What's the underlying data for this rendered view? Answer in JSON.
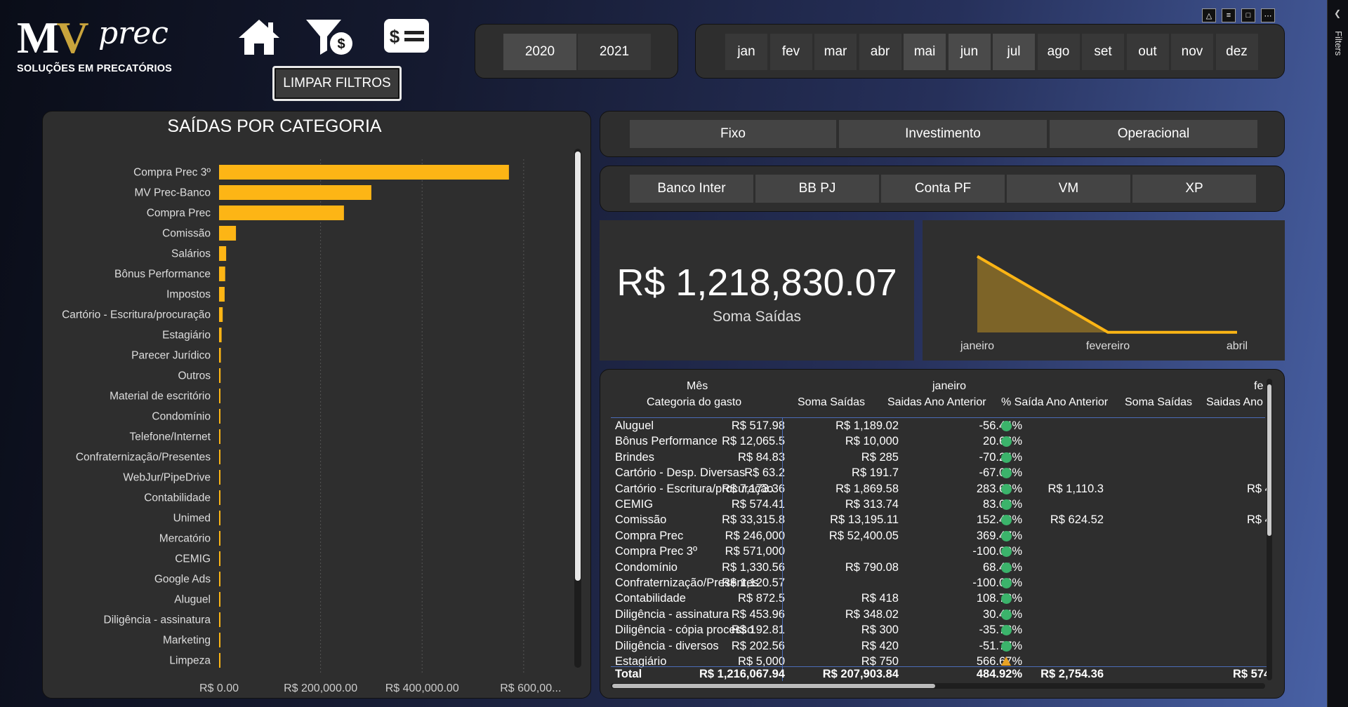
{
  "logo": {
    "text_main": "MV",
    "text_script": "prec",
    "subtitle": "SOLUÇÕES EM PRECATÓRIOS"
  },
  "header": {
    "clear_filters": "LIMPAR FILTROS",
    "icons": [
      "home-icon",
      "filter-money-icon",
      "money-list-icon"
    ]
  },
  "years": {
    "items": [
      "2020",
      "2021"
    ],
    "selected": "2020"
  },
  "months": {
    "items": [
      "jan",
      "fev",
      "mar",
      "abr",
      "mai",
      "jun",
      "jul",
      "ago",
      "set",
      "out",
      "nov",
      "dez"
    ],
    "selected": [
      "mai",
      "jun",
      "jul"
    ]
  },
  "categories_slicer": [
    "Fixo",
    "Investimento",
    "Operacional"
  ],
  "accounts_slicer": [
    "Banco Inter",
    "BB PJ",
    "Conta PF",
    "VM",
    "XP"
  ],
  "filters_pane": {
    "label": "Filters"
  },
  "kpi": {
    "value": "R$ 1,218,830.07",
    "label": "Soma Saídas"
  },
  "colors": {
    "bar": "#fdb515",
    "area_fill": "#7d6428",
    "area_line": "#fdb515",
    "positive_dot": "#3bb36b",
    "warning": "#e8a224"
  },
  "chart_data": [
    {
      "type": "bar",
      "orientation": "horizontal",
      "title": "SAÍDAS POR CATEGORIA",
      "categories": [
        "Compra Prec 3º",
        "MV Prec-Banco",
        "Compra Prec",
        "Comissão",
        "Salários",
        "Bônus Performance",
        "Impostos",
        "Cartório - Escritura/procuração",
        "Estagiário",
        "Parecer Jurídico",
        "Outros",
        "Material de escritório",
        "Condomínio",
        "Telefone/Internet",
        "Confraternização/Presentes",
        "WebJur/PipeDrive",
        "Contabilidade",
        "Unimed",
        "Mercatório",
        "CEMIG",
        "Google Ads",
        "Aluguel",
        "Diligência - assinatura",
        "Marketing",
        "Limpeza"
      ],
      "values": [
        571000,
        300000,
        246000,
        33316,
        14000,
        12066,
        11000,
        7173,
        5000,
        3500,
        3000,
        2500,
        1331,
        1300,
        1121,
        1000,
        873,
        800,
        700,
        574,
        550,
        518,
        454,
        400,
        300
      ],
      "xlim": [
        0,
        650000
      ],
      "ticks": [
        "R$ 0.00",
        "R$ 200,000.00",
        "R$ 400,000.00",
        "R$ 600,00..."
      ],
      "tick_values": [
        0,
        200000,
        400000,
        600000
      ]
    },
    {
      "type": "area",
      "categories": [
        "janeiro",
        "fevereiro",
        "abril"
      ],
      "values": [
        1216067.94,
        2754.36,
        2700
      ],
      "ylim": [
        0,
        1300000
      ]
    },
    {
      "type": "table",
      "column_group_label": "Mês",
      "row_header": "Categoria do gasto",
      "month_groups": [
        "janeiro",
        "fe"
      ],
      "columns": [
        "Soma Saídas",
        "Saidas Ano Anterior",
        "% Saída Ano Anterior",
        "Soma Saídas",
        "Saidas Ano"
      ],
      "rows": [
        {
          "cat": "Aluguel",
          "jan_sum": "R$ 517.98",
          "jan_prev": "R$ 1,189.02",
          "jan_pct": "-56.44%",
          "indicator": "dot",
          "feb_sum": "",
          "feb_prev": ""
        },
        {
          "cat": "Bônus Performance",
          "jan_sum": "R$ 12,065.5",
          "jan_prev": "R$ 10,000",
          "jan_pct": "20.66%",
          "indicator": "dot",
          "feb_sum": "",
          "feb_prev": ""
        },
        {
          "cat": "Brindes",
          "jan_sum": "R$ 84.83",
          "jan_prev": "R$ 285",
          "jan_pct": "-70.24%",
          "indicator": "dot",
          "feb_sum": "",
          "feb_prev": ""
        },
        {
          "cat": "Cartório - Desp. Diversas",
          "jan_sum": "R$ 63.2",
          "jan_prev": "R$ 191.7",
          "jan_pct": "-67.03%",
          "indicator": "dot",
          "feb_sum": "",
          "feb_prev": ""
        },
        {
          "cat": "Cartório - Escritura/procuração",
          "jan_sum": "R$ 7,173.36",
          "jan_prev": "R$ 1,869.58",
          "jan_pct": "283.69%",
          "indicator": "dot",
          "feb_sum": "R$ 1,110.3",
          "feb_prev": "R$ 4"
        },
        {
          "cat": "CEMIG",
          "jan_sum": "R$ 574.41",
          "jan_prev": "R$ 313.74",
          "jan_pct": "83.08%",
          "indicator": "dot",
          "feb_sum": "",
          "feb_prev": ""
        },
        {
          "cat": "Comissão",
          "jan_sum": "R$ 33,315.8",
          "jan_prev": "R$ 13,195.11",
          "jan_pct": "152.49%",
          "indicator": "dot",
          "feb_sum": "R$ 624.52",
          "feb_prev": "R$ 4"
        },
        {
          "cat": "Compra Prec",
          "jan_sum": "R$ 246,000",
          "jan_prev": "R$ 52,400.05",
          "jan_pct": "369.47%",
          "indicator": "dot",
          "feb_sum": "",
          "feb_prev": ""
        },
        {
          "cat": "Compra Prec 3º",
          "jan_sum": "R$ 571,000",
          "jan_prev": "",
          "jan_pct": "-100.00%",
          "indicator": "dot",
          "feb_sum": "",
          "feb_prev": ""
        },
        {
          "cat": "Condomínio",
          "jan_sum": "R$ 1,330.56",
          "jan_prev": "R$ 790.08",
          "jan_pct": "68.41%",
          "indicator": "dot",
          "feb_sum": "",
          "feb_prev": ""
        },
        {
          "cat": "Confraternização/Presentes",
          "jan_sum": "R$ 1,120.57",
          "jan_prev": "",
          "jan_pct": "-100.00%",
          "indicator": "dot",
          "feb_sum": "",
          "feb_prev": ""
        },
        {
          "cat": "Contabilidade",
          "jan_sum": "R$ 872.5",
          "jan_prev": "R$ 418",
          "jan_pct": "108.73%",
          "indicator": "dot",
          "feb_sum": "",
          "feb_prev": ""
        },
        {
          "cat": "Diligência - assinatura",
          "jan_sum": "R$ 453.96",
          "jan_prev": "R$ 348.02",
          "jan_pct": "30.44%",
          "indicator": "dot",
          "feb_sum": "",
          "feb_prev": ""
        },
        {
          "cat": "Diligência - cópia processo",
          "jan_sum": "R$ 192.81",
          "jan_prev": "R$ 300",
          "jan_pct": "-35.73%",
          "indicator": "dot",
          "feb_sum": "",
          "feb_prev": ""
        },
        {
          "cat": "Diligência - diversos",
          "jan_sum": "R$ 202.56",
          "jan_prev": "R$ 420",
          "jan_pct": "-51.77%",
          "indicator": "dot",
          "feb_sum": "",
          "feb_prev": ""
        },
        {
          "cat": "Estagiário",
          "jan_sum": "R$ 5,000",
          "jan_prev": "R$ 750",
          "jan_pct": "566.67%",
          "indicator": "triangle",
          "feb_sum": "",
          "feb_prev": ""
        }
      ],
      "total": {
        "label": "Total",
        "jan_sum": "R$ 1,216,067.94",
        "jan_prev": "R$ 207,903.84",
        "jan_pct": "484.92%",
        "feb_sum": "R$ 2,754.36",
        "feb_prev": "R$ 574"
      }
    }
  ]
}
